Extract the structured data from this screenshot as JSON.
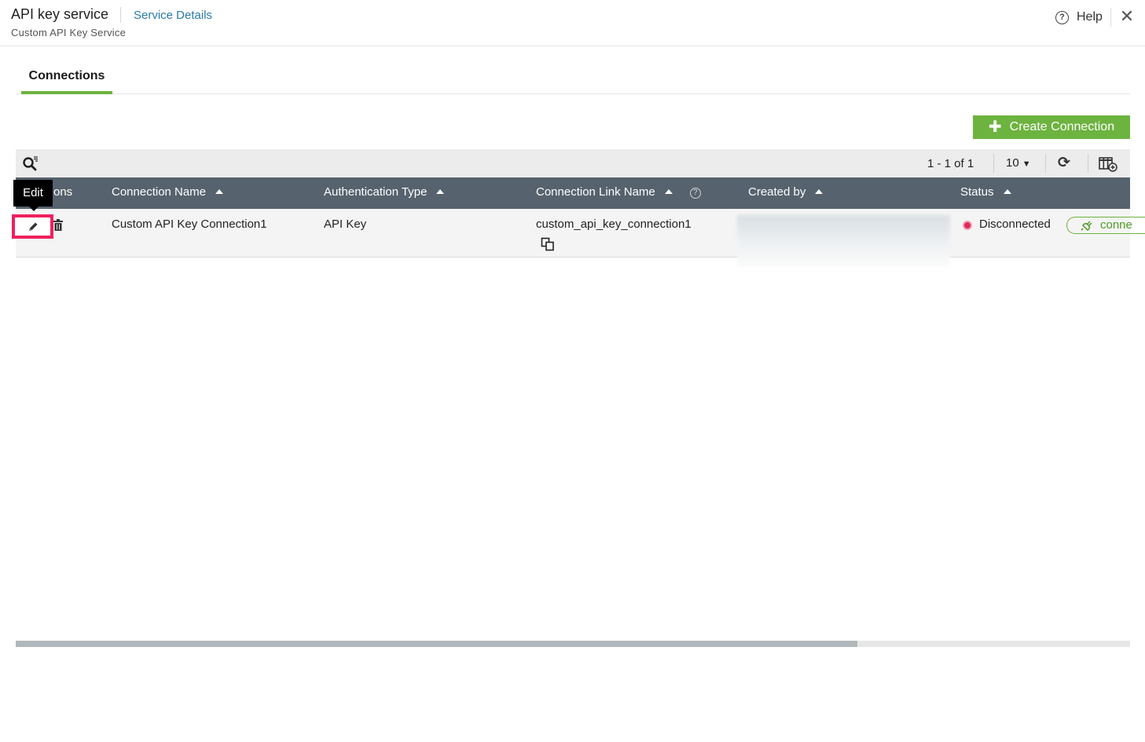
{
  "header": {
    "title": "API key service",
    "service_link": "Service Details",
    "subtitle": "Custom API Key Service",
    "help_label": "Help",
    "help_icon_glyph": "?",
    "close_glyph": "✕"
  },
  "tabs": [
    {
      "label": "Connections",
      "active": true
    }
  ],
  "create_button": {
    "label": "Create Connection",
    "icon": "plus-icon"
  },
  "toolbar": {
    "pager_text": "1 - 1 of 1",
    "page_size": "10",
    "icons": [
      "search-icon",
      "refresh-icon",
      "columns-settings-icon"
    ]
  },
  "table": {
    "columns": [
      {
        "label": "Actions",
        "visible_label": "ons",
        "sortable": false
      },
      {
        "label": "Connection Name",
        "sortable": true
      },
      {
        "label": "Authentication Type",
        "sortable": true
      },
      {
        "label": "Connection Link Name",
        "sortable": true,
        "has_help": true
      },
      {
        "label": "Created by",
        "sortable": true
      },
      {
        "label": "Status",
        "sortable": true
      }
    ],
    "rows": [
      {
        "connection_name": "Custom API Key Connection1",
        "auth_type": "API Key",
        "link_name": "custom_api_key_connection1",
        "status": "Disconnected",
        "action_label": "conne"
      }
    ]
  },
  "tooltip": {
    "text": "Edit"
  },
  "colors": {
    "accent_green": "#6db33f",
    "link_blue": "#2a7aa8",
    "table_header": "#56626d",
    "status_disconnected": "#e02a5a",
    "highlight": "#f0205e"
  }
}
